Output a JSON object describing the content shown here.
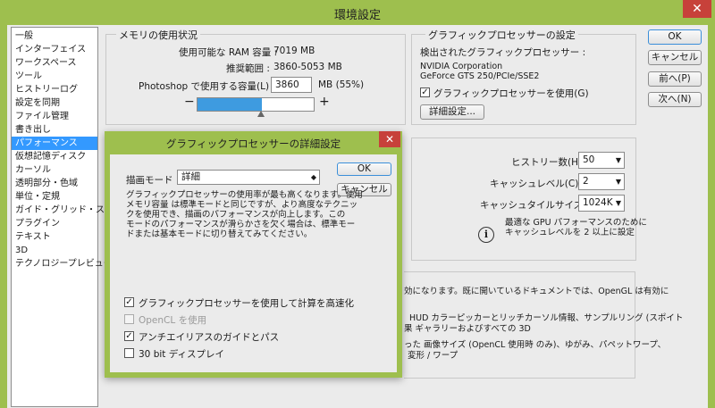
{
  "window": {
    "title": "環境設定",
    "close": "✕"
  },
  "sidebar": {
    "items": [
      {
        "label": "一般"
      },
      {
        "label": "インターフェイス"
      },
      {
        "label": "ワークスペース"
      },
      {
        "label": "ツール"
      },
      {
        "label": "ヒストリーログ"
      },
      {
        "label": "設定を同期"
      },
      {
        "label": "ファイル管理"
      },
      {
        "label": "書き出し"
      },
      {
        "label": "パフォーマンス",
        "selected": true
      },
      {
        "label": "仮想記憶ディスク"
      },
      {
        "label": "カーソル"
      },
      {
        "label": "透明部分・色域"
      },
      {
        "label": "単位・定規"
      },
      {
        "label": "ガイド・グリッド・スライス"
      },
      {
        "label": "プラグイン"
      },
      {
        "label": "テキスト"
      },
      {
        "label": "3D"
      },
      {
        "label": "テクノロジープレビュー"
      }
    ]
  },
  "memory": {
    "title": "メモリの使用状況",
    "available_label": "使用可能な RAM 容量 :",
    "available_value": "7019 MB",
    "range_label": "推奨範囲 :",
    "range_value": "3860-5053 MB",
    "use_label": "Photoshop で使用する容量(L) :",
    "use_value": "3860",
    "use_unit": "MB (55%)",
    "minus": "−",
    "plus": "+",
    "slider_fraction": 0.55
  },
  "gpu": {
    "title": "グラフィックプロセッサーの設定",
    "detected_label": "検出されたグラフィックプロセッサー :",
    "vendor": "NVIDIA Corporation",
    "model": "GeForce GTS 250/PCIe/SSE2",
    "use_gpu_label": "グラフィックプロセッサーを使用(G)",
    "use_gpu_checked": true,
    "advanced_button": "詳細設定..."
  },
  "buttons": {
    "ok": "OK",
    "cancel": "キャンセル",
    "prev": "前へ(P)",
    "next": "次へ(N)"
  },
  "history": {
    "history_label": "ヒストリー数(H) :",
    "history_value": "50",
    "cache_label": "キャッシュレベル(C) :",
    "cache_value": "2",
    "tile_label": "キャッシュタイルサイズ(Z) :",
    "tile_value": "1024K",
    "hint_line1": "最適な GPU パフォーマンスのために",
    "hint_line2": "キャッシュレベルを 2 以上に設定",
    "info_icon": "i"
  },
  "bottom_text": {
    "line1": "効になります。既に開いているドキュメントでは、OpenGL は有効に",
    "line2": "HUD カラーピッカーとリッチカーソル情報、サンプルリング (スポイト",
    "line3": "果 ギャラリーおよびすべての 3D",
    "line4": "った 画像サイズ (OpenCL 使用時 のみ)、ゆがみ、パペットワープ、",
    "line5": "変形 / ワープ"
  },
  "dialog": {
    "title": "グラフィックプロセッサーの詳細設定",
    "close": "✕",
    "mode_label": "描画モード :",
    "mode_value": "詳細",
    "ok": "OK",
    "cancel": "キャンセル",
    "desc1": "グラフィックプロセッサーの使用率が最も高くなります。使用",
    "desc2": "メモリ容量 は標準モードと同じですが、より高度なテクニッ",
    "desc3": "クを使用でき、描画のパフォーマンスが向上します。この",
    "desc4": "モードのパフォーマンスが滑らかさを欠く場合は、標準モー",
    "desc5": "ドまたは基本モードに切り替えてみてください。",
    "opt_compute": {
      "label": "グラフィックプロセッサーを使用して計算を高速化",
      "checked": true
    },
    "opt_opencl": {
      "label": "OpenCL を使用",
      "checked": false,
      "disabled": true
    },
    "opt_aa": {
      "label": "アンチエイリアスのガイドとパス",
      "checked": true
    },
    "opt_30bit": {
      "label": "30 bit ディスプレイ",
      "checked": false
    }
  }
}
